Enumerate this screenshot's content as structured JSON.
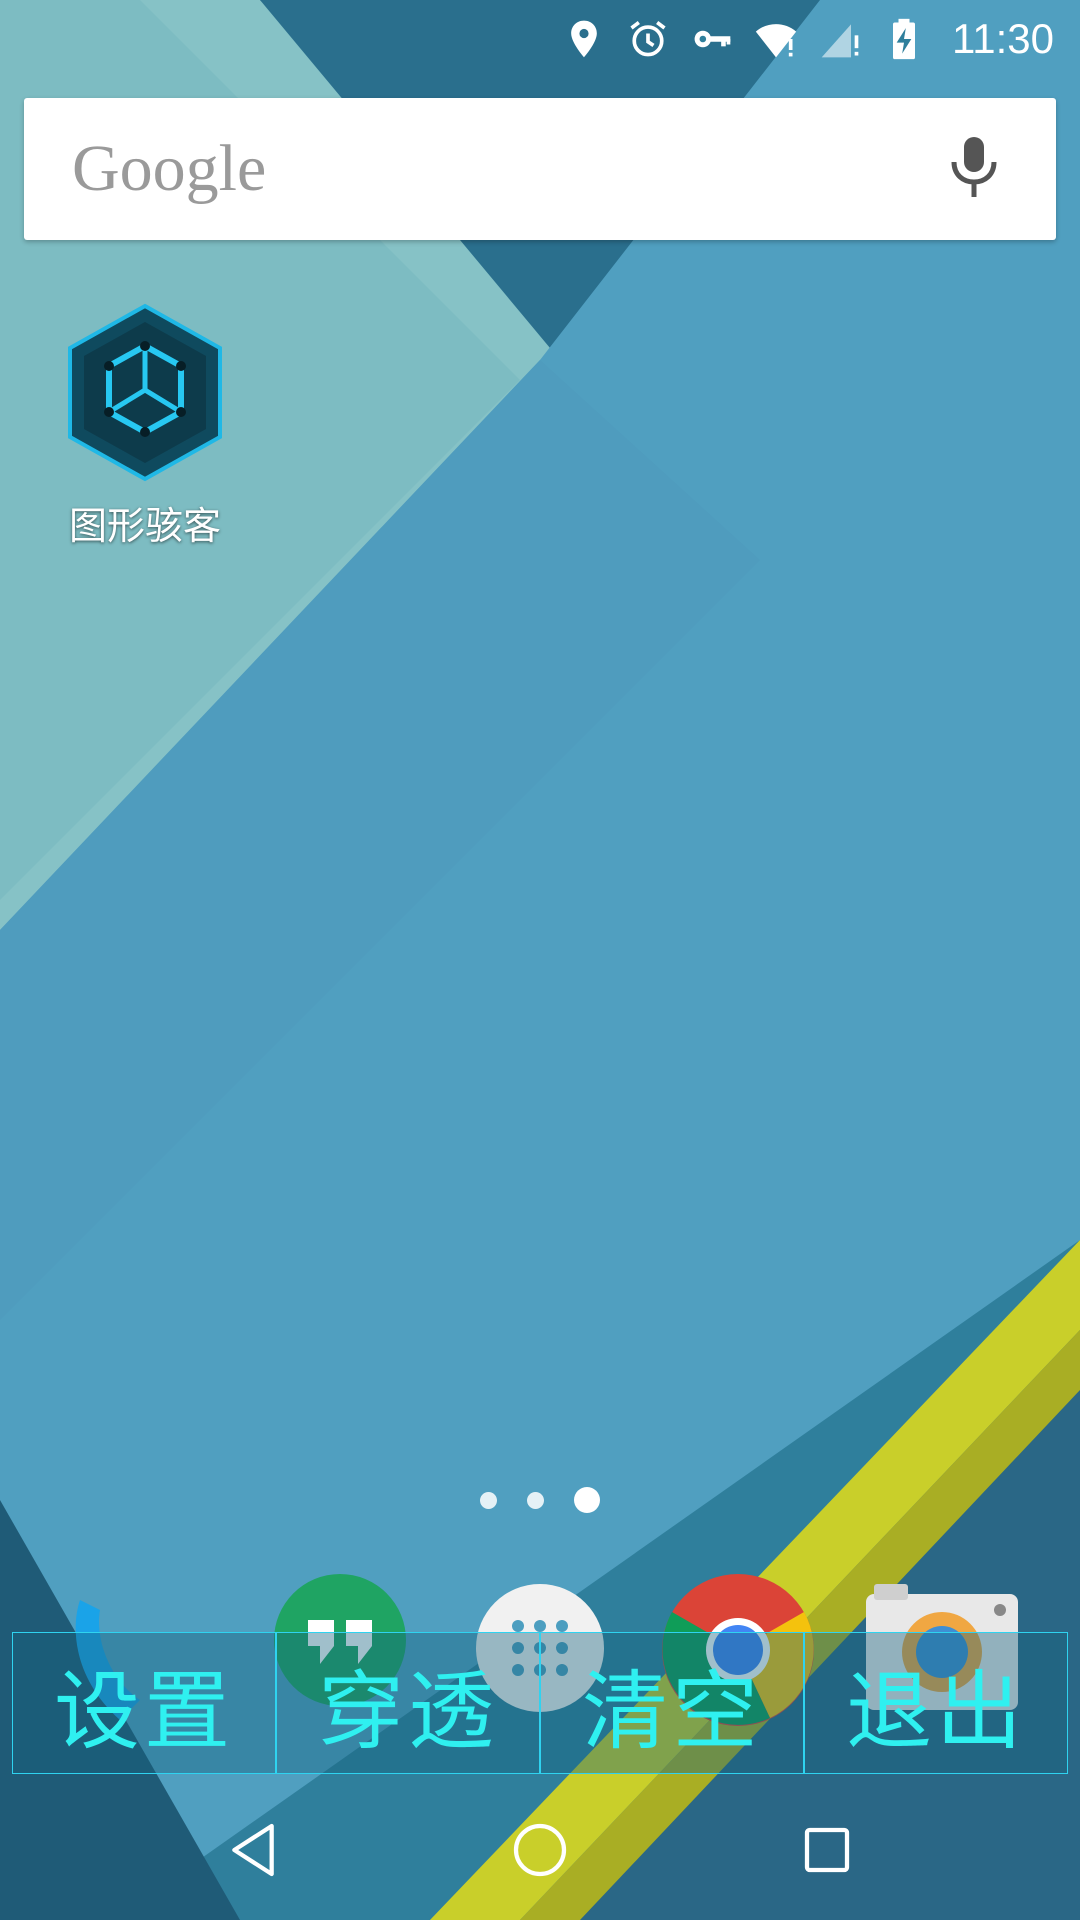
{
  "status_bar": {
    "time": "11:30",
    "icons": [
      "location-icon",
      "alarm-icon",
      "vpn-key-icon",
      "wifi-icon",
      "cell-signal-icon",
      "battery-charging-icon"
    ]
  },
  "search": {
    "logo_text": "Google",
    "mic_icon": "microphone-icon"
  },
  "home_apps": [
    {
      "label": "图形骇客",
      "icon": "graphics-hacker-hexagon-icon"
    }
  ],
  "page_indicator": {
    "pages": 3,
    "active": 3
  },
  "dock": {
    "apps": [
      "phone-icon",
      "hangouts-icon",
      "app-drawer-icon",
      "chrome-icon",
      "camera-icon"
    ]
  },
  "overlay_toolbar": {
    "buttons": [
      "设置",
      "穿透",
      "清空",
      "退出"
    ],
    "accent_color": "#2ff0f0"
  },
  "nav_bar": {
    "buttons": [
      "back-icon",
      "home-icon",
      "recents-icon"
    ]
  }
}
